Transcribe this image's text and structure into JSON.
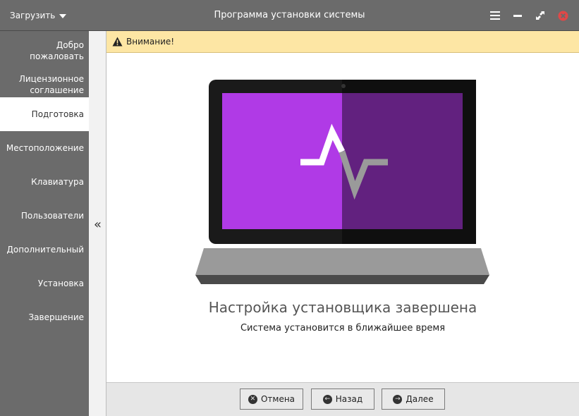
{
  "titlebar": {
    "load_menu": "Загрузить",
    "title": "Программа установки системы",
    "controls": [
      "menu-icon",
      "minimize-icon",
      "maximize-icon",
      "close-icon"
    ]
  },
  "sidebar": {
    "steps": [
      {
        "label": "Добро пожаловать",
        "active": false
      },
      {
        "label": "Лицензионное соглашение",
        "active": false
      },
      {
        "label": "Подготовка",
        "active": true
      },
      {
        "label": "Местоположение",
        "active": false
      },
      {
        "label": "Клавиатура",
        "active": false
      },
      {
        "label": "Пользователи",
        "active": false
      },
      {
        "label": "Дополнительный",
        "active": false
      },
      {
        "label": "Установка",
        "active": false
      },
      {
        "label": "Завершение",
        "active": false
      }
    ],
    "collapse_glyph": "«"
  },
  "warning": {
    "text": "Внимание!",
    "icon": "warning-icon"
  },
  "content": {
    "heading": "Настройка установщика завершена",
    "subheading": "Система установится в ближайшее время"
  },
  "footer": {
    "cancel": "Отмена",
    "back": "Назад",
    "next": "Далее"
  },
  "colors": {
    "sidebar_bg": "#6b6b6b",
    "warning_bg": "#fde6a4",
    "screen_left": "#b03ae6",
    "screen_right": "#62217f",
    "laptop_frame": "#1a1a1a",
    "laptop_base": "#9a9a9a"
  }
}
